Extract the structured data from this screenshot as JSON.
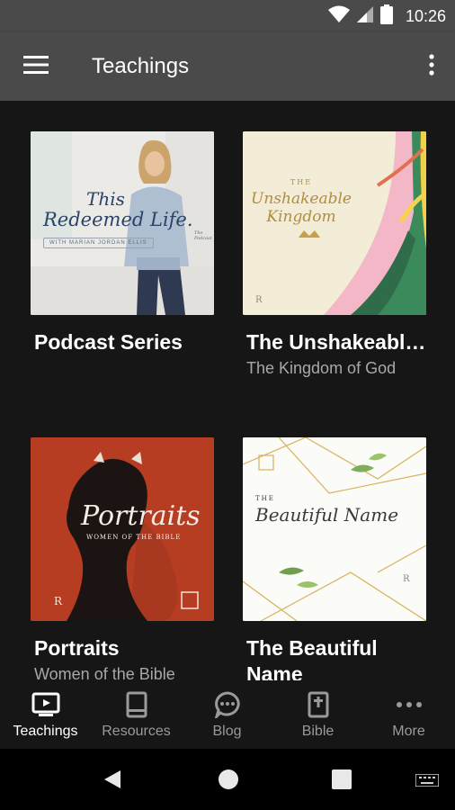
{
  "status_bar": {
    "time": "10:26",
    "icons": [
      "wifi-icon",
      "signal-icon",
      "battery-icon"
    ]
  },
  "app_bar": {
    "title": "Teachings",
    "menu_icon": "hamburger-menu-icon",
    "overflow_icon": "more-vertical-icon"
  },
  "cards": [
    {
      "title": "Podcast Series",
      "subtitle": "",
      "art": {
        "line1": "This",
        "line2": "Redeemed Life.",
        "host": "WITH MARIAN JORDAN ELLIS",
        "tag": "The Podcast"
      }
    },
    {
      "title": "The Unshakeable Kingdom",
      "subtitle": "The Kingdom of God",
      "art": {
        "line1": "THE",
        "line2": "Unshakeable",
        "line3": "Kingdom",
        "mark": "R"
      }
    },
    {
      "title": "Portraits",
      "subtitle": "Women of the Bible",
      "art": {
        "line1": "Portraits",
        "line2": "WOMEN OF THE BIBLE",
        "mark": "R"
      }
    },
    {
      "title": "The Beautiful Name",
      "subtitle": "",
      "art": {
        "line1": "THE",
        "line2": "Beautiful Name",
        "mark": "R"
      }
    }
  ],
  "bottom_nav": [
    {
      "label": "Teachings",
      "icon": "tv-icon",
      "active": true
    },
    {
      "label": "Resources",
      "icon": "book-icon",
      "active": false
    },
    {
      "label": "Blog",
      "icon": "chat-bubble-icon",
      "active": false
    },
    {
      "label": "Bible",
      "icon": "bible-icon",
      "active": false
    },
    {
      "label": "More",
      "icon": "more-horizontal-icon",
      "active": false
    }
  ],
  "colors": {
    "app_bar": "#4a4a4a",
    "background": "#161616",
    "subtitle": "#a8a8a8",
    "nav_inactive": "#9a9a9a",
    "portraits_red": "#b63d22"
  }
}
